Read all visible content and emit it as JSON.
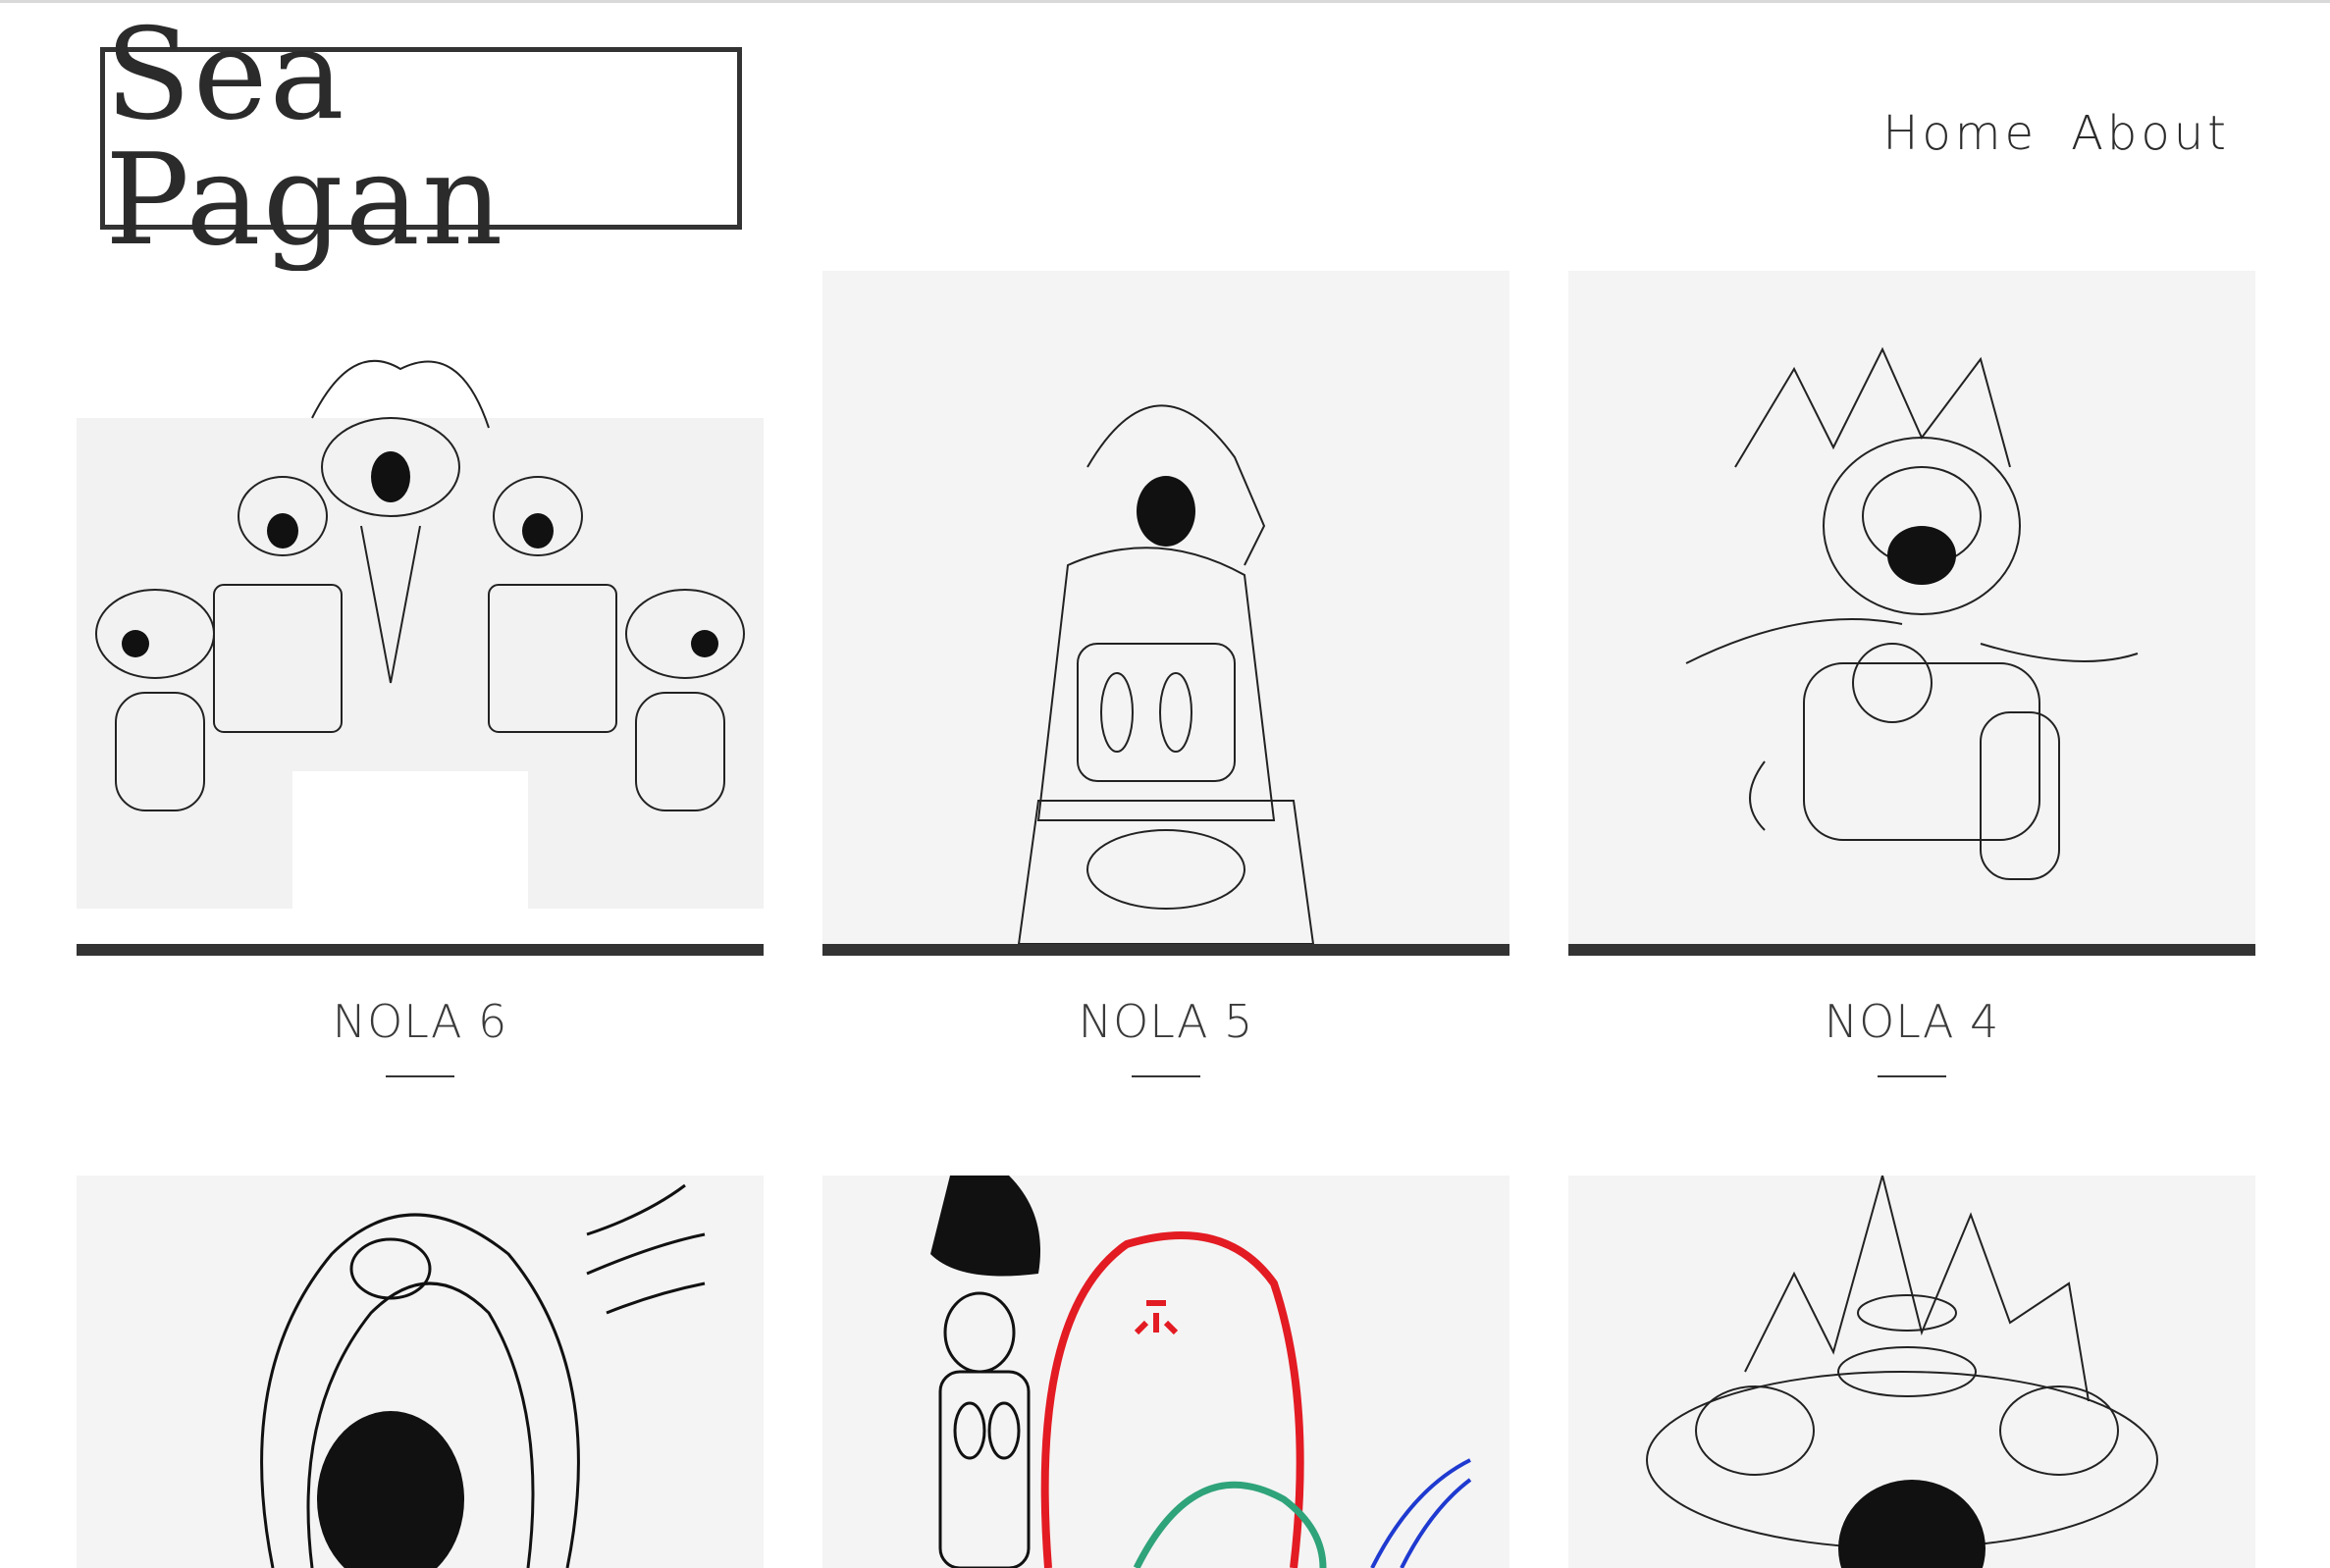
{
  "site": {
    "title": "Sea Pagan"
  },
  "nav": {
    "items": [
      {
        "label": "Home"
      },
      {
        "label": "About"
      }
    ]
  },
  "gallery": {
    "items": [
      {
        "title": "NOLA 6",
        "image_icon": "drawing-thumbnail"
      },
      {
        "title": "NOLA 5",
        "image_icon": "drawing-thumbnail"
      },
      {
        "title": "NOLA 4",
        "image_icon": "drawing-thumbnail"
      },
      {
        "title": "",
        "image_icon": "drawing-thumbnail"
      },
      {
        "title": "",
        "image_icon": "drawing-thumbnail"
      },
      {
        "title": "",
        "image_icon": "drawing-thumbnail"
      }
    ]
  },
  "colors": {
    "text": "#2f2f2f",
    "accent_bar": "#333333",
    "thumb_bg": "#f3f3f3"
  }
}
